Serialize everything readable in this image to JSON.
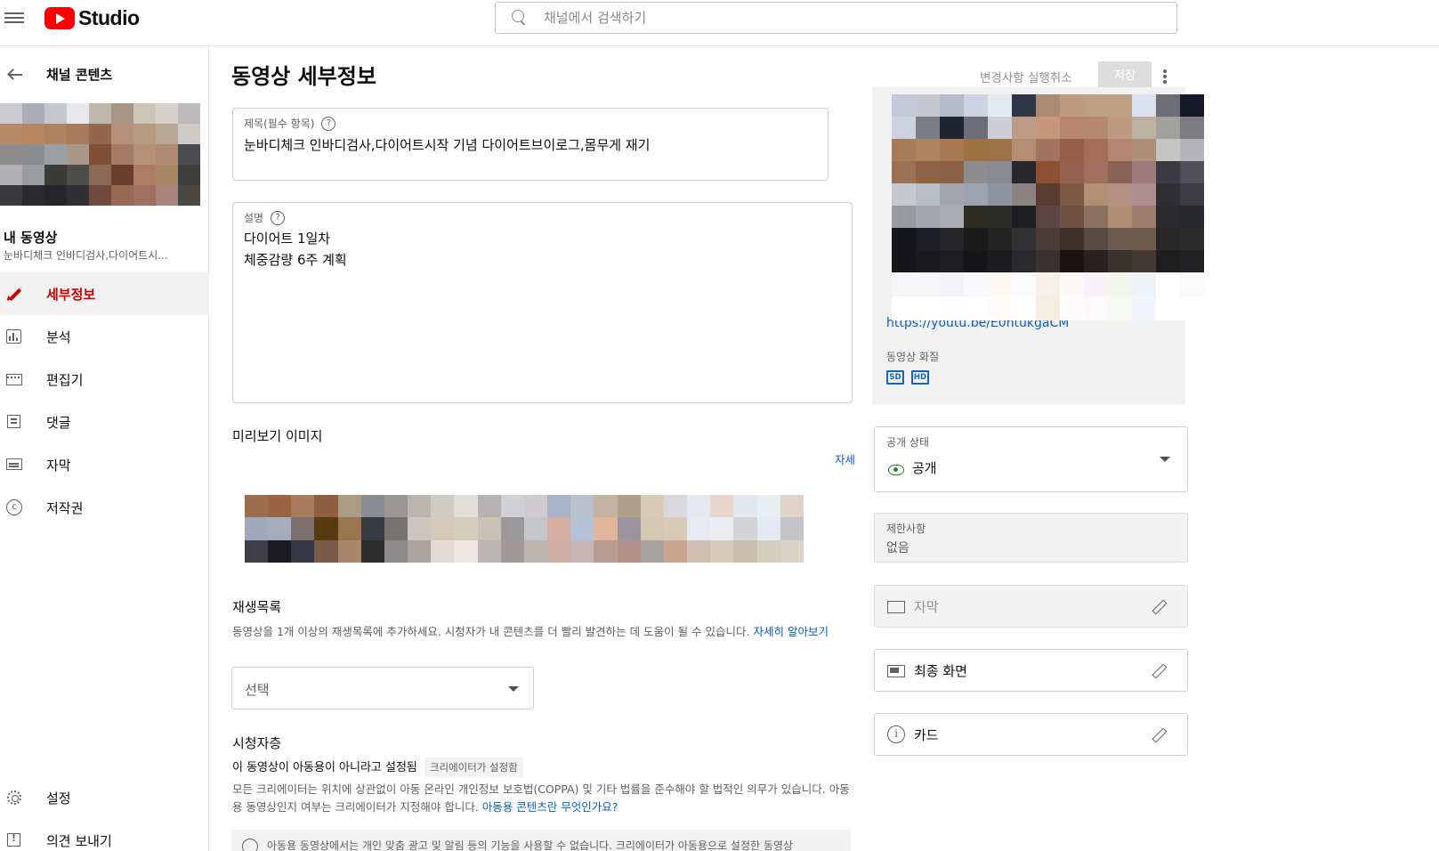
{
  "app": {
    "logo_text": "Studio",
    "search_placeholder": "채널에서 검색하기"
  },
  "sidebar": {
    "back_label": "채널 콘텐츠",
    "my_video_label": "내 동영상",
    "video_title_short": "눈바디체크 인바디검사,다이어트시...",
    "nav_items": [
      {
        "label": "세부정보",
        "icon": "pencil-icon",
        "active": true
      },
      {
        "label": "분석",
        "icon": "analytics-icon",
        "active": false
      },
      {
        "label": "편집기",
        "icon": "editor-icon",
        "active": false
      },
      {
        "label": "댓글",
        "icon": "comments-icon",
        "active": false
      },
      {
        "label": "자막",
        "icon": "subtitles-icon",
        "active": false
      },
      {
        "label": "저작권",
        "icon": "copyright-icon",
        "active": false
      }
    ],
    "bottom_items": [
      {
        "label": "설정",
        "icon": "gear-icon"
      },
      {
        "label": "의견 보내기",
        "icon": "feedback-icon"
      }
    ]
  },
  "main": {
    "page_title": "동영상 세부정보",
    "title_field": {
      "label": "제목(필수 항목)",
      "value": "눈바디체크 인바디검사,다이어트시작 기념 다이어트브이로그,몸무게 재기"
    },
    "description_field": {
      "label": "설명",
      "lines": [
        "다이어트 1일차",
        "체중감량 6주 계획"
      ]
    },
    "thumbnail": {
      "title": "미리보기 이미지",
      "link_fragment": "자세"
    },
    "playlist": {
      "title": "재생목록",
      "description": "동영상을 1개 이상의 재생목록에 추가하세요. 시청자가 내 콘텐츠를 더 빨리 발견하는 데 도움이 될 수 있습니다.",
      "learn_more": "자세히 알아보기",
      "select_value": "선택"
    },
    "audience": {
      "title": "시청자층",
      "status": "이 동영상이 아동용이 아니라고 설정됨",
      "chip": "크리에이터가 설정함",
      "description": "모든 크리에이터는 위치에 상관없이 아동 온라인 개인정보 보호법(COPPA) 및 기타 법률을 준수해야 할 법적인 의무가 있습니다. 아동용 동영상인지 여부는 크리에이터가 지정해야 합니다.",
      "link": "아동용 콘텐츠란 무엇인가요?",
      "notice": "아동용 동영상에서는 개인 맞춤 광고 및 알림 등의 기능을 사용할 수 없습니다. 크리에이터가 아동용으로 설정한 동영상"
    }
  },
  "right": {
    "undo_label": "변경사항 실행취소",
    "save_label": "저장",
    "video_link": "https://youtu.be/E0ntukgaCM",
    "quality_label": "동영상 화질",
    "quality_badges": [
      "SD",
      "HD"
    ],
    "visibility": {
      "label": "공개 상태",
      "value": "공개"
    },
    "restrictions": {
      "label": "제한사항",
      "value": "없음"
    },
    "subtitles": {
      "label": "자막"
    },
    "end_screen": {
      "label": "최종 화면"
    },
    "cards": {
      "label": "카드"
    },
    "colors": {
      "brand_red": "#ff0000",
      "active_red": "#cc0000",
      "link_blue": "#065fd4",
      "public_green": "#2e7d32"
    }
  }
}
